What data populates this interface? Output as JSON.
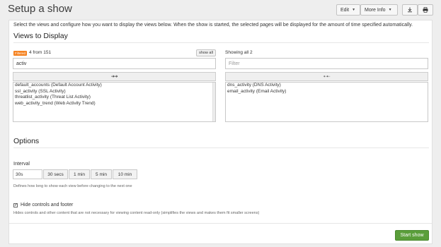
{
  "header": {
    "title": "Setup a show",
    "edit_label": "Edit",
    "more_info_label": "More Info",
    "download_icon": "download-icon",
    "print_icon": "print-icon"
  },
  "intro": "Select the views and configure how you want to display the views below. When the show is started, the selected pages will be displayed for the amount of time specified automatically.",
  "views": {
    "heading": "Views to Display",
    "available": {
      "badge": "Filtered",
      "count_text": "4 from 151",
      "show_all_label": "show all",
      "filter_value": "activ",
      "move_label": "➔➔",
      "items": [
        "default_accounts (Default Account Activity)",
        "ssl_activity (SSL Activity)",
        "threatlist_activity (Threat List Activity)",
        "web_activity_trend (Web Activity Trend)"
      ]
    },
    "selected": {
      "count_text": "Showing all 2",
      "filter_placeholder": "Filter",
      "move_label": "⇠⇠",
      "items": [
        "dns_activity (DNS Activity)",
        "email_activity (Email Activity)"
      ]
    }
  },
  "options": {
    "heading": "Options",
    "interval_label": "Interval",
    "interval_value": "30s",
    "presets": [
      "30 secs",
      "1 min",
      "5 min",
      "10 min"
    ],
    "interval_help": "Defines how long to show each view before changing to the next one",
    "hide_controls_label": "Hide controls and footer",
    "hide_controls_checked": true,
    "hide_controls_help": "Hides controls and other content that are not necessary for viewing content read-only (simplifies the views and makes them fit smaller screens)"
  },
  "start_label": "Start show",
  "colors": {
    "primary": "#5a9e3a",
    "badge": "#f58220"
  }
}
